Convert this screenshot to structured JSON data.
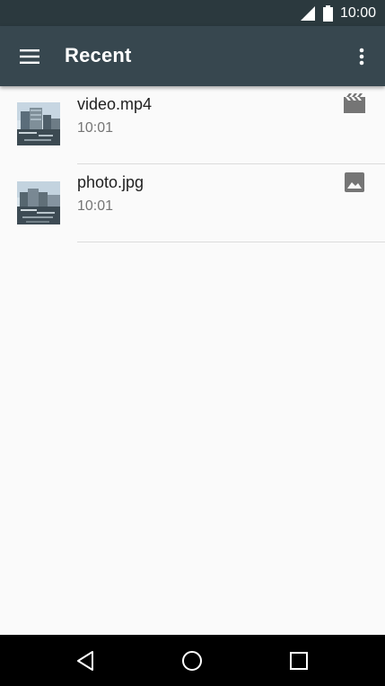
{
  "status_bar": {
    "time": "10:00",
    "icons": [
      "signal-icon",
      "battery-icon"
    ]
  },
  "app_bar": {
    "title": "Recent",
    "menu_icon": "hamburger-menu-icon",
    "overflow_icon": "more-vert-icon",
    "background": "#37474f"
  },
  "files": [
    {
      "name": "video.mp4",
      "time": "10:01",
      "type_icon": "movie-icon"
    },
    {
      "name": "photo.jpg",
      "time": "10:01",
      "type_icon": "image-icon"
    }
  ],
  "nav_bar": {
    "buttons": [
      "back-icon",
      "home-icon",
      "recents-icon"
    ]
  }
}
